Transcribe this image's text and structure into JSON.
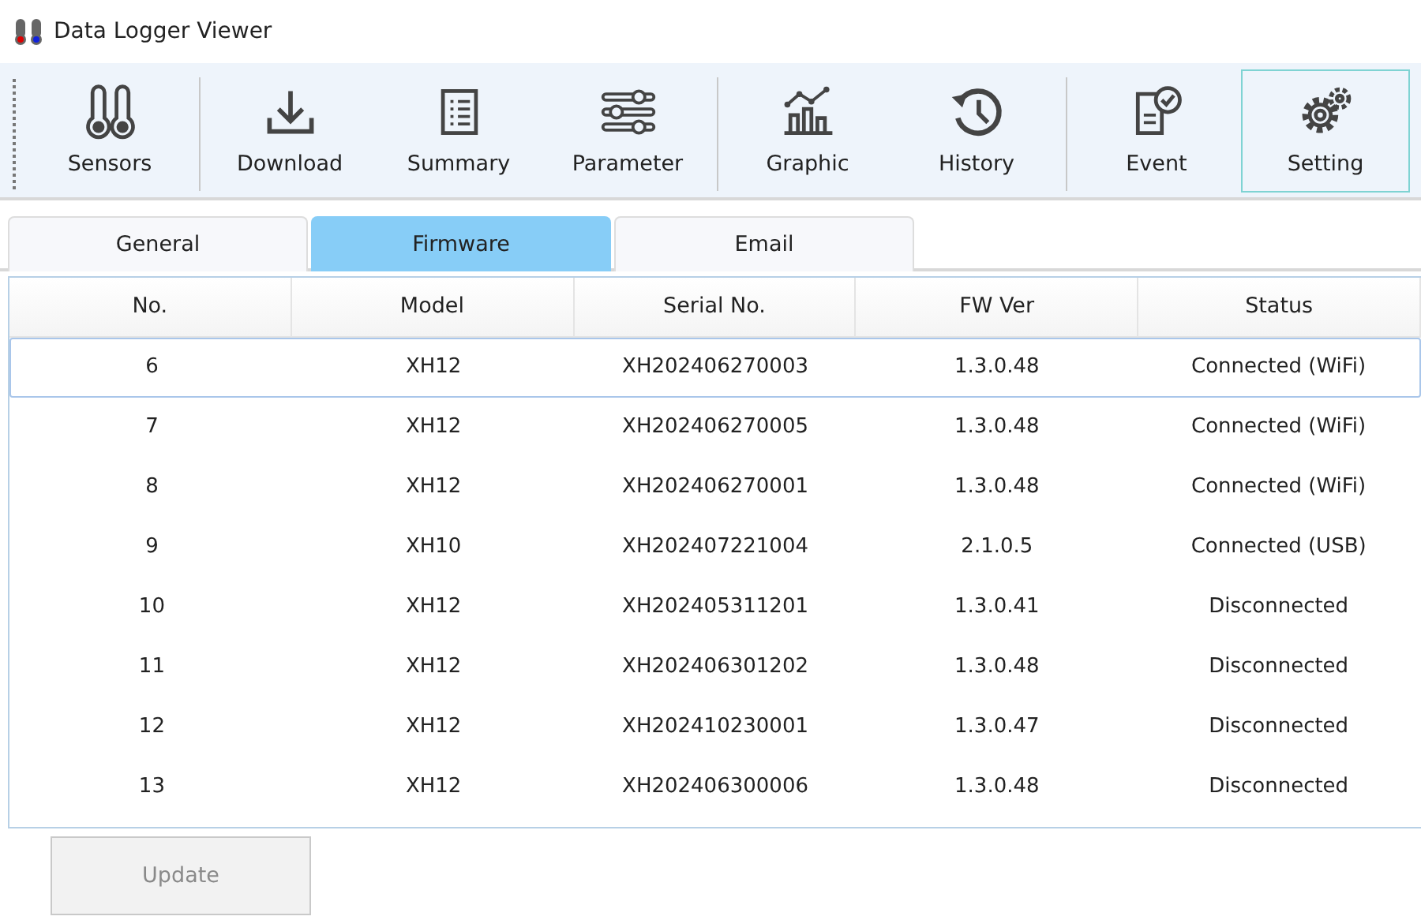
{
  "window": {
    "title": "Data Logger Viewer"
  },
  "toolbar": [
    [
      {
        "label": "Sensors",
        "selected": false
      }
    ],
    [
      {
        "label": "Download",
        "selected": false
      },
      {
        "label": "Summary",
        "selected": false
      },
      {
        "label": "Parameter",
        "selected": false
      }
    ],
    [
      {
        "label": "Graphic",
        "selected": false
      },
      {
        "label": "History",
        "selected": false
      }
    ],
    [
      {
        "label": "Event",
        "selected": false
      },
      {
        "label": "Setting",
        "selected": true
      }
    ]
  ],
  "tabs": [
    {
      "label": "General",
      "selected": false
    },
    {
      "label": "Firmware",
      "selected": true
    },
    {
      "label": "Email",
      "selected": false
    }
  ],
  "table": {
    "columns": [
      "No.",
      "Model",
      "Serial No.",
      "FW Ver",
      "Status"
    ],
    "rows": [
      {
        "selected": true,
        "cells": [
          "6",
          "XH12",
          "XH202406270003",
          "1.3.0.48",
          "Connected (WiFi)"
        ]
      },
      {
        "selected": false,
        "cells": [
          "7",
          "XH12",
          "XH202406270005",
          "1.3.0.48",
          "Connected (WiFi)"
        ]
      },
      {
        "selected": false,
        "cells": [
          "8",
          "XH12",
          "XH202406270001",
          "1.3.0.48",
          "Connected (WiFi)"
        ]
      },
      {
        "selected": false,
        "cells": [
          "9",
          "XH10",
          "XH202407221004",
          "2.1.0.5",
          "Connected (USB)"
        ]
      },
      {
        "selected": false,
        "cells": [
          "10",
          "XH12",
          "XH202405311201",
          "1.3.0.41",
          "Disconnected"
        ]
      },
      {
        "selected": false,
        "cells": [
          "11",
          "XH12",
          "XH202406301202",
          "1.3.0.48",
          "Disconnected"
        ]
      },
      {
        "selected": false,
        "cells": [
          "12",
          "XH12",
          "XH202410230001",
          "1.3.0.47",
          "Disconnected"
        ]
      },
      {
        "selected": false,
        "cells": [
          "13",
          "XH12",
          "XH202406300006",
          "1.3.0.48",
          "Disconnected"
        ]
      }
    ]
  },
  "update_button": {
    "label": "Update",
    "disabled": true
  }
}
